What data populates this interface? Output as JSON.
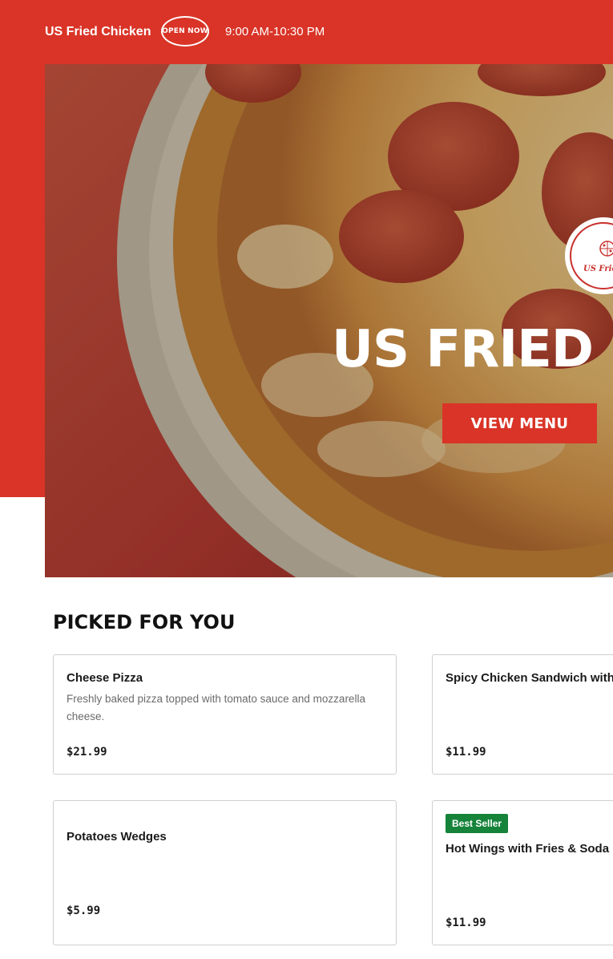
{
  "header": {
    "brand": "US Fried Chicken",
    "open_badge": "OPEN NOW",
    "hours": "9:00 AM-10:30 PM"
  },
  "hero": {
    "title": "US FRIED",
    "cta_label": "VIEW MENU",
    "logo_text": "US Fried",
    "overlay_color": "#1e1e1e"
  },
  "colors": {
    "brand_red": "#d93427",
    "best_seller_green": "#16833a"
  },
  "section": {
    "title": "PICKED FOR YOU"
  },
  "items": [
    {
      "name": "Cheese Pizza",
      "description": "Freshly baked pizza topped with tomato sauce and mozzarella cheese.",
      "price": "$21.99",
      "badge": ""
    },
    {
      "name": "Spicy Chicken Sandwich with",
      "description": "",
      "price": "$11.99",
      "badge": ""
    },
    {
      "name": "Potatoes Wedges",
      "description": "",
      "price": "$5.99",
      "badge": ""
    },
    {
      "name": "Hot Wings with Fries & Soda",
      "description": "",
      "price": "$11.99",
      "badge": "Best Seller"
    }
  ]
}
